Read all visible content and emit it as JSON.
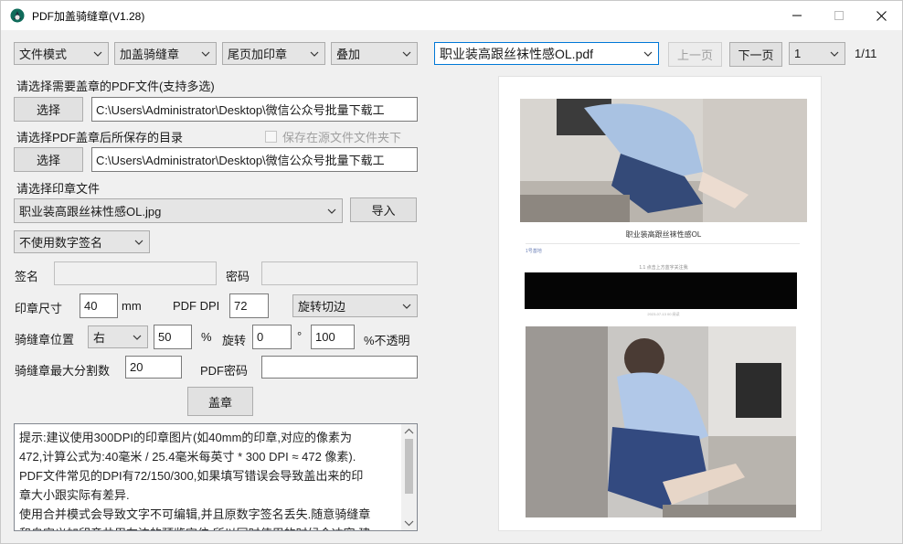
{
  "window": {
    "title": "PDF加盖骑缝章(V1.28)",
    "icon": "app-icon",
    "minimize_icon": "minimize-icon",
    "maximize_icon": "maximize-icon",
    "close_icon": "close-icon"
  },
  "toolbar": {
    "mode": "文件模式",
    "stamp_type": "加盖骑缝章",
    "last_page": "尾页加印章",
    "overlay": "叠加",
    "file_select": "职业装高跟丝袜性感OL.pdf",
    "prev_page": "上一页",
    "next_page": "下一页",
    "page_select": "1",
    "page_count": "1/11"
  },
  "source": {
    "label": "请选择需要盖章的PDF文件(支持多选)",
    "button": "选择",
    "path": "C:\\Users\\Administrator\\Desktop\\微信公众号批量下载工"
  },
  "output": {
    "label": "请选择PDF盖章后所保存的目录",
    "save_in_source_label": "保存在源文件文件夹下",
    "save_in_source_checked": false,
    "button": "选择",
    "path": "C:\\Users\\Administrator\\Desktop\\微信公众号批量下载工"
  },
  "stamp_file": {
    "label": "请选择印章文件",
    "selected": "职业装高跟丝袜性感OL.jpg",
    "import_button": "导入"
  },
  "signature": {
    "mode": "不使用数字签名",
    "name_label": "签名",
    "name_value": "",
    "password_label": "密码",
    "password_value": ""
  },
  "settings": {
    "size_label": "印章尺寸",
    "size_value": "40",
    "size_unit": "mm",
    "dpi_label": "PDF DPI",
    "dpi_value": "72",
    "rotate_mode": "旋转切边",
    "position_label": "骑缝章位置",
    "position_value": "右",
    "position_percent": "50",
    "percent_sign": "%",
    "rotate_label": "旋转",
    "rotate_value": "0",
    "degree_sign": "°",
    "opacity_value": "100",
    "opacity_label": "%不透明",
    "max_split_label": "骑缝章最大分割数",
    "max_split_value": "20",
    "pdf_password_label": "PDF密码",
    "pdf_password_value": "",
    "stamp_button": "盖章"
  },
  "notes": {
    "lines": [
      "提示:建议使用300DPI的印章图片(如40mm的印章,对应的像素为",
      "472,计算公式为:40毫米 / 25.4毫米每英寸 * 300 DPI ≈ 472 像素).",
      "PDF文件常见的DPI有72/150/300,如果填写错误会导致盖出来的印",
      "章大小跟实际有差异.",
      "使用合并模式会导致文字不可编辑,并且原数字签名丢失.随意骑缝章",
      "和自定义加印章共用左边的预览定位,所以同时使用的时候会冲突,建"
    ]
  },
  "preview": {
    "article_title": "职业装高跟丝袜性感OL",
    "author": "1号基地",
    "follow_hint": "1.1 点击上方蓝字关注我",
    "date_text": "2023-07-13 00 阅读"
  }
}
